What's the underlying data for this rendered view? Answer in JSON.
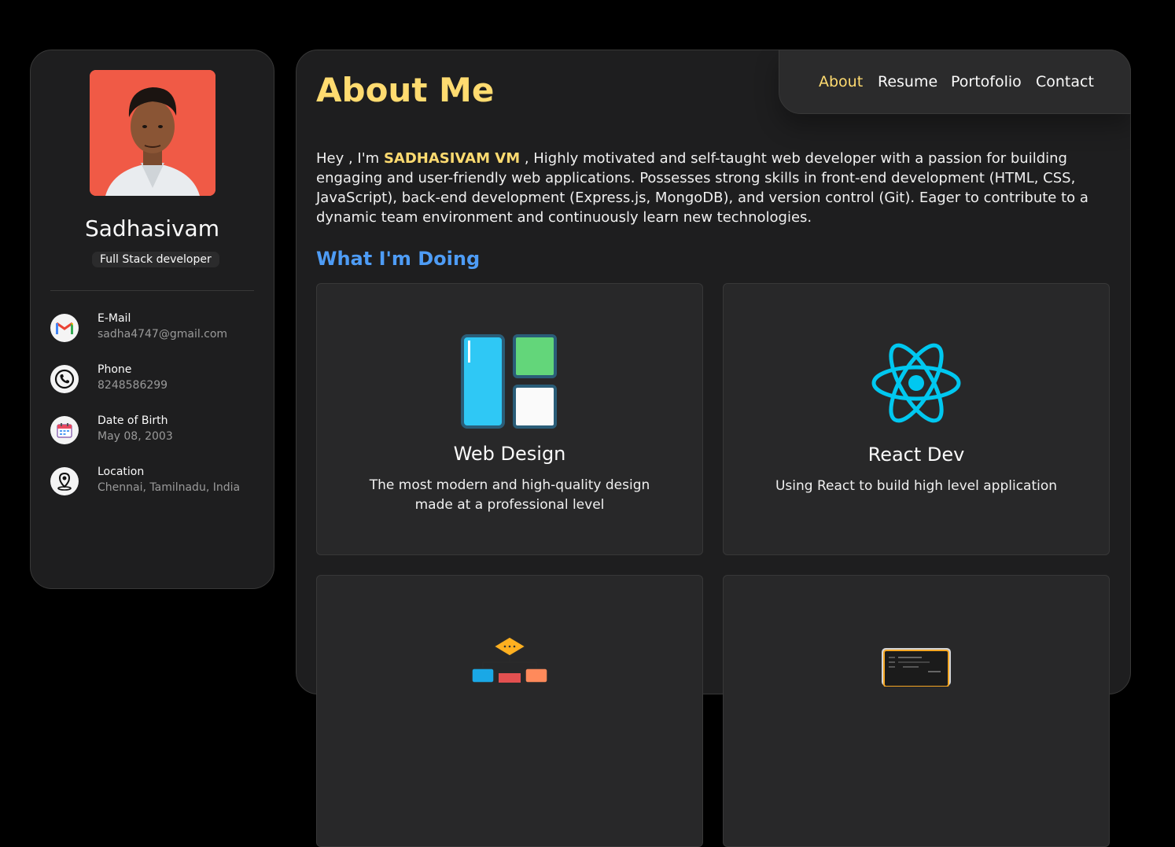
{
  "profile": {
    "name": "Sadhasivam",
    "role": "Full Stack developer"
  },
  "contacts": [
    {
      "title": "E-Mail",
      "value": "sadha4747@gmail.com",
      "icon": "gmail-icon"
    },
    {
      "title": "Phone",
      "value": "8248586299",
      "icon": "phone-icon"
    },
    {
      "title": "Date of Birth",
      "value": "May 08, 2003",
      "icon": "calendar-icon"
    },
    {
      "title": "Location",
      "value": "Chennai, Tamilnadu, India",
      "icon": "location-pin-icon"
    }
  ],
  "nav": {
    "items": [
      "About",
      "Resume",
      "Portofolio",
      "Contact"
    ],
    "active": "About"
  },
  "about": {
    "title": "About Me",
    "intro_prefix": "Hey , I'm ",
    "highlight_name": "SADHASIVAM VM",
    "intro_rest": " , Highly motivated and self-taught web developer with a passion for building engaging and user-friendly web applications. Possesses strong skills in front-end development (HTML, CSS, JavaScript), back-end development (Express.js, MongoDB), and version control (Git). Eager to contribute to a dynamic team environment and continuously learn new technologies."
  },
  "services": {
    "heading": "What I'm Doing",
    "items": [
      {
        "title": "Web Design",
        "description": "The most modern and high-quality design made at a professional level",
        "icon": "web-design-icon"
      },
      {
        "title": "React Dev",
        "description": "Using React to build high level application",
        "icon": "react-icon"
      },
      {
        "title": "",
        "description": "",
        "icon": "flowchart-icon"
      },
      {
        "title": "",
        "description": "",
        "icon": "code-window-icon"
      }
    ]
  },
  "colors": {
    "accent": "#ffdb70",
    "heading_blue": "#4e9cf5",
    "background": "#000000",
    "card": "#1e1e1f"
  }
}
